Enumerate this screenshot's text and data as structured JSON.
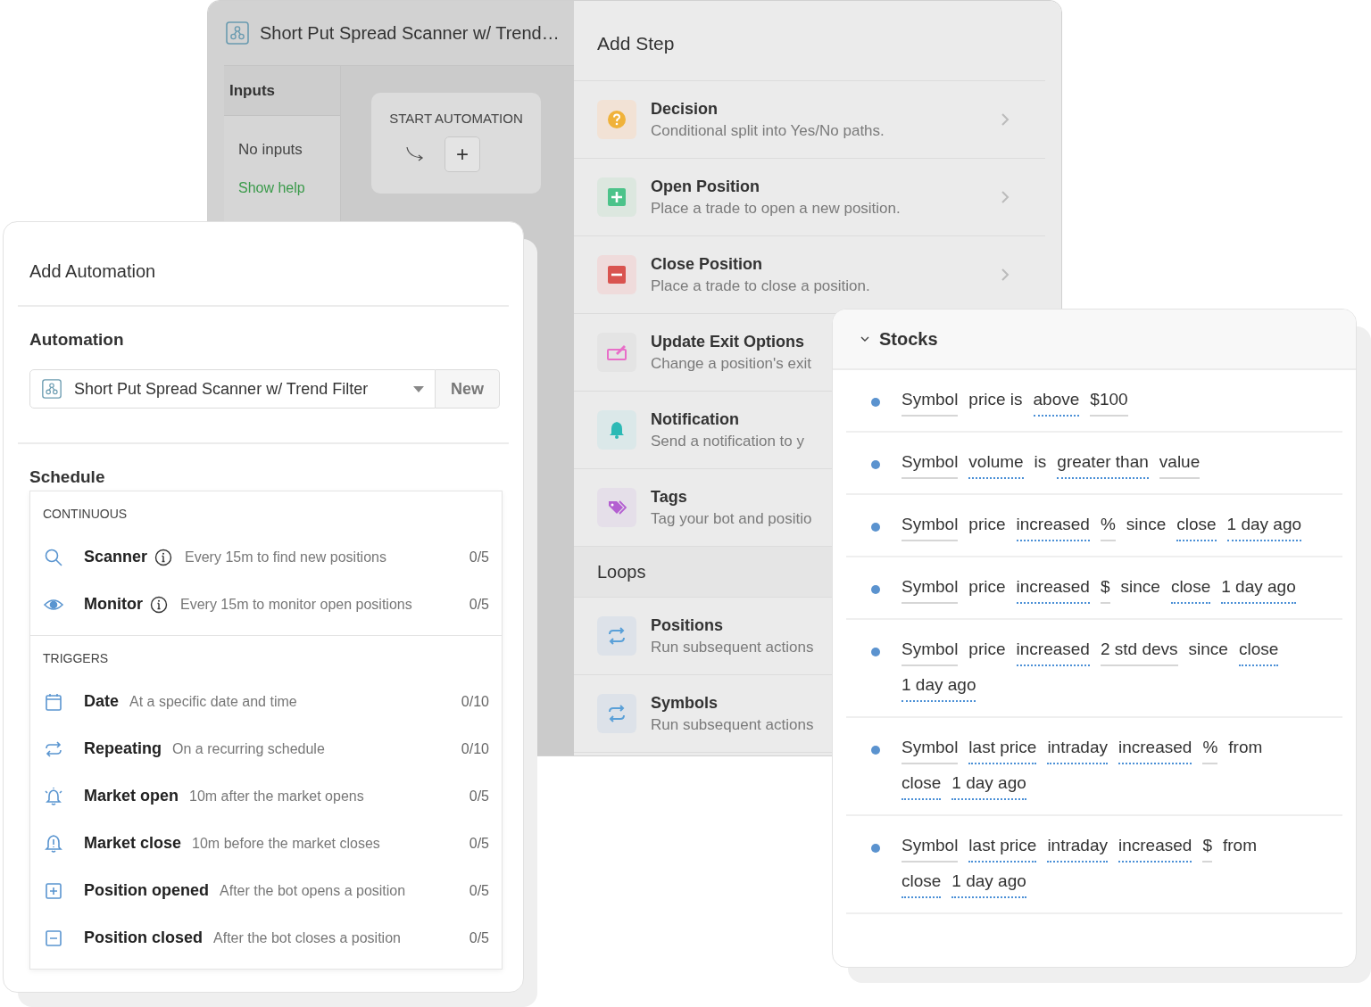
{
  "flow_window": {
    "title": "Short Put Spread Scanner w/ Trend…",
    "inputs": {
      "heading": "Inputs",
      "empty_text": "No inputs",
      "help_link": "Show help"
    },
    "start_node": {
      "label": "START AUTOMATION",
      "add_button": "+"
    }
  },
  "add_step": {
    "title": "Add Step",
    "items": [
      {
        "kind": "decision",
        "title": "Decision",
        "description": "Conditional split into Yes/No paths.",
        "chevron": true
      },
      {
        "kind": "open",
        "title": "Open Position",
        "description": "Place a trade to open a new position.",
        "chevron": true
      },
      {
        "kind": "close",
        "title": "Close Position",
        "description": "Place a trade to close a position.",
        "chevron": true
      },
      {
        "kind": "exit",
        "title": "Update Exit Options",
        "description": "Change a position's exit",
        "chevron": false
      },
      {
        "kind": "notification",
        "title": "Notification",
        "description": "Send a notification to y",
        "chevron": false
      },
      {
        "kind": "tags",
        "title": "Tags",
        "description": "Tag your bot and positio",
        "chevron": false
      }
    ],
    "loops_title": "Loops",
    "loops": [
      {
        "kind": "loop",
        "title": "Positions",
        "description": "Run subsequent actions"
      },
      {
        "kind": "loop",
        "title": "Symbols",
        "description": "Run subsequent actions"
      }
    ]
  },
  "add_automation": {
    "title": "Add Automation",
    "automation_label": "Automation",
    "automation_value": "Short Put Spread Scanner w/ Trend Filter",
    "new_button": "New",
    "schedule_label": "Schedule",
    "sections": [
      {
        "heading": "CONTINUOUS",
        "items": [
          {
            "kind": "search",
            "name": "Scanner",
            "info": true,
            "description": "Every 15m to find new positions",
            "count": "0/5"
          },
          {
            "kind": "eye",
            "name": "Monitor",
            "info": true,
            "description": "Every 15m to monitor open positions",
            "count": "0/5"
          }
        ]
      },
      {
        "heading": "TRIGGERS",
        "items": [
          {
            "kind": "calendar",
            "name": "Date",
            "info": false,
            "description": "At a specific date and time",
            "count": "0/10"
          },
          {
            "kind": "repeat",
            "name": "Repeating",
            "info": false,
            "description": "On a recurring schedule",
            "count": "0/10"
          },
          {
            "kind": "bell-ring",
            "name": "Market open",
            "info": false,
            "description": "10m after the market opens",
            "count": "0/5"
          },
          {
            "kind": "bell-alert",
            "name": "Market close",
            "info": false,
            "description": "10m before the market closes",
            "count": "0/5"
          },
          {
            "kind": "plus",
            "name": "Position opened",
            "info": false,
            "description": "After the bot opens a position",
            "count": "0/5"
          },
          {
            "kind": "minus",
            "name": "Position closed",
            "info": false,
            "description": "After the bot closes a position",
            "count": "0/5"
          }
        ]
      }
    ]
  },
  "stocks": {
    "title": "Stocks",
    "expanded": true,
    "conditions": [
      {
        "tokens": [
          {
            "text": "Symbol",
            "kind": "field"
          },
          {
            "text": "price is",
            "kind": "plain"
          },
          {
            "text": "above",
            "kind": "choice"
          },
          {
            "text": "$100",
            "kind": "field"
          }
        ]
      },
      {
        "tokens": [
          {
            "text": "Symbol",
            "kind": "field"
          },
          {
            "text": "volume",
            "kind": "choice"
          },
          {
            "text": "is",
            "kind": "plain"
          },
          {
            "text": "greater than",
            "kind": "choice"
          },
          {
            "text": "value",
            "kind": "field"
          }
        ]
      },
      {
        "tokens": [
          {
            "text": "Symbol",
            "kind": "field"
          },
          {
            "text": "price",
            "kind": "plain"
          },
          {
            "text": "increased",
            "kind": "choice"
          },
          {
            "text": "%",
            "kind": "field"
          },
          {
            "text": "since",
            "kind": "plain"
          },
          {
            "text": "close",
            "kind": "choice"
          },
          {
            "text": "1 day ago",
            "kind": "choice"
          }
        ]
      },
      {
        "tokens": [
          {
            "text": "Symbol",
            "kind": "field"
          },
          {
            "text": "price",
            "kind": "plain"
          },
          {
            "text": "increased",
            "kind": "choice"
          },
          {
            "text": "$",
            "kind": "field"
          },
          {
            "text": "since",
            "kind": "plain"
          },
          {
            "text": "close",
            "kind": "choice"
          },
          {
            "text": "1 day ago",
            "kind": "choice"
          }
        ]
      },
      {
        "tokens": [
          {
            "text": "Symbol",
            "kind": "field"
          },
          {
            "text": "price",
            "kind": "plain"
          },
          {
            "text": "increased",
            "kind": "choice"
          },
          {
            "text": "2 std devs",
            "kind": "field"
          },
          {
            "text": "since",
            "kind": "plain"
          },
          {
            "text": "close",
            "kind": "choice"
          },
          {
            "text": "1 day ago",
            "kind": "choice"
          }
        ]
      },
      {
        "tokens": [
          {
            "text": "Symbol",
            "kind": "field"
          },
          {
            "text": "last price",
            "kind": "choice"
          },
          {
            "text": "intraday",
            "kind": "choice"
          },
          {
            "text": "increased",
            "kind": "choice"
          },
          {
            "text": "%",
            "kind": "field"
          },
          {
            "text": "from",
            "kind": "plain"
          },
          {
            "text": "close",
            "kind": "choice"
          },
          {
            "text": "1 day ago",
            "kind": "choice"
          }
        ]
      },
      {
        "tokens": [
          {
            "text": "Symbol",
            "kind": "field"
          },
          {
            "text": "last price",
            "kind": "choice"
          },
          {
            "text": "intraday",
            "kind": "choice"
          },
          {
            "text": "increased",
            "kind": "choice"
          },
          {
            "text": "$",
            "kind": "field"
          },
          {
            "text": "from",
            "kind": "plain"
          },
          {
            "text": "close",
            "kind": "choice"
          },
          {
            "text": "1 day ago",
            "kind": "choice"
          }
        ]
      }
    ]
  }
}
